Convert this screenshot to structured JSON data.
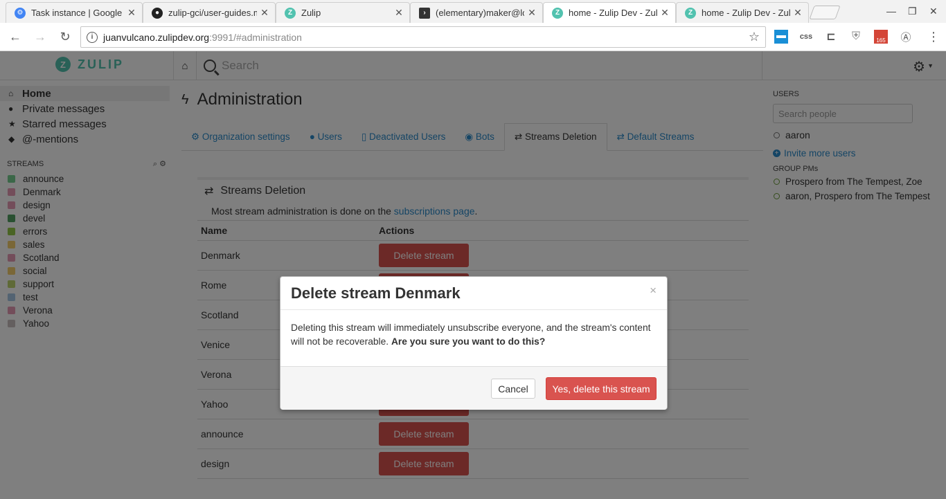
{
  "browser": {
    "tabs": [
      {
        "title": "Task instance | Google C",
        "icon": "gear-favicon",
        "color": "#4285f4"
      },
      {
        "title": "zulip-gci/user-guides.m",
        "icon": "github-favicon",
        "color": "#222222"
      },
      {
        "title": "Zulip",
        "icon": "zulip-favicon",
        "color": "#52c2af"
      },
      {
        "title": "(elementary)maker@loc",
        "icon": "terminal-favicon",
        "color": "#333333"
      },
      {
        "title": "home - Zulip Dev - Zulip",
        "icon": "zulip-favicon",
        "color": "#52c2af"
      },
      {
        "title": "home - Zulip Dev - Zulip",
        "icon": "zulip-favicon",
        "color": "#52c2af"
      }
    ],
    "url_host": "juanvulcano.zulipdev.org",
    "url_path": ":9991/#administration",
    "extensions": {
      "css": "css",
      "gmail_count": "165"
    }
  },
  "app": {
    "logo_text": "ZULIP",
    "logo_mark": "Z",
    "search_placeholder": "Search",
    "nav": [
      {
        "label": "Home",
        "icon": "home-icon"
      },
      {
        "label": "Private messages",
        "icon": "user-icon"
      },
      {
        "label": "Starred messages",
        "icon": "star-icon"
      },
      {
        "label": "@-mentions",
        "icon": "tag-icon"
      }
    ],
    "streams_header": "STREAMS",
    "streams": [
      {
        "name": "announce",
        "color": "#76ce90"
      },
      {
        "name": "Denmark",
        "color": "#e79ab5"
      },
      {
        "name": "design",
        "color": "#e79ab5"
      },
      {
        "name": "devel",
        "color": "#53a063"
      },
      {
        "name": "errors",
        "color": "#94c849"
      },
      {
        "name": "sales",
        "color": "#f5ce6e"
      },
      {
        "name": "Scotland",
        "color": "#e79ab5"
      },
      {
        "name": "social",
        "color": "#f5ce6e"
      },
      {
        "name": "support",
        "color": "#bfd56f"
      },
      {
        "name": "test",
        "color": "#a6c7e5"
      },
      {
        "name": "Verona",
        "color": "#e79ab5"
      },
      {
        "name": "Yahoo",
        "color": "#c8bebf"
      }
    ],
    "admin_title": "Administration",
    "admin_tabs": [
      {
        "label": "Organization settings",
        "icon": "gear-icon"
      },
      {
        "label": "Users",
        "icon": "user-icon"
      },
      {
        "label": "Deactivated Users",
        "icon": "trash-icon"
      },
      {
        "label": "Bots",
        "icon": "github-icon"
      },
      {
        "label": "Streams Deletion",
        "icon": "exchange-icon",
        "active": true
      },
      {
        "label": "Default Streams",
        "icon": "exchange-icon"
      }
    ],
    "panel_title": "Streams Deletion",
    "panel_note_prefix": "Most stream administration is done on the ",
    "panel_note_link": "subscriptions page",
    "panel_note_suffix": ".",
    "table_headers": {
      "name": "Name",
      "actions": "Actions"
    },
    "table_rows": [
      "Denmark",
      "Rome",
      "Scotland",
      "Venice",
      "Verona",
      "Yahoo",
      "announce",
      "design"
    ],
    "delete_button_label": "Delete stream",
    "right": {
      "users_header": "USERS",
      "search_people_placeholder": "Search people",
      "users": [
        "aaron"
      ],
      "invite_label": "Invite more users",
      "group_pms_header": "GROUP PMs",
      "group_pms": [
        "Prospero from The Tempest, Zoe",
        "aaron, Prospero from The Tempest"
      ]
    }
  },
  "modal": {
    "title": "Delete stream Denmark",
    "close_glyph": "×",
    "body_text": "Deleting this stream will immediately unsubscribe everyone, and the stream's content will not be recoverable. ",
    "body_bold": "Are you sure you want to do this?",
    "cancel_label": "Cancel",
    "confirm_label": "Yes, delete this stream",
    "confirm_color": "#d9534f"
  }
}
